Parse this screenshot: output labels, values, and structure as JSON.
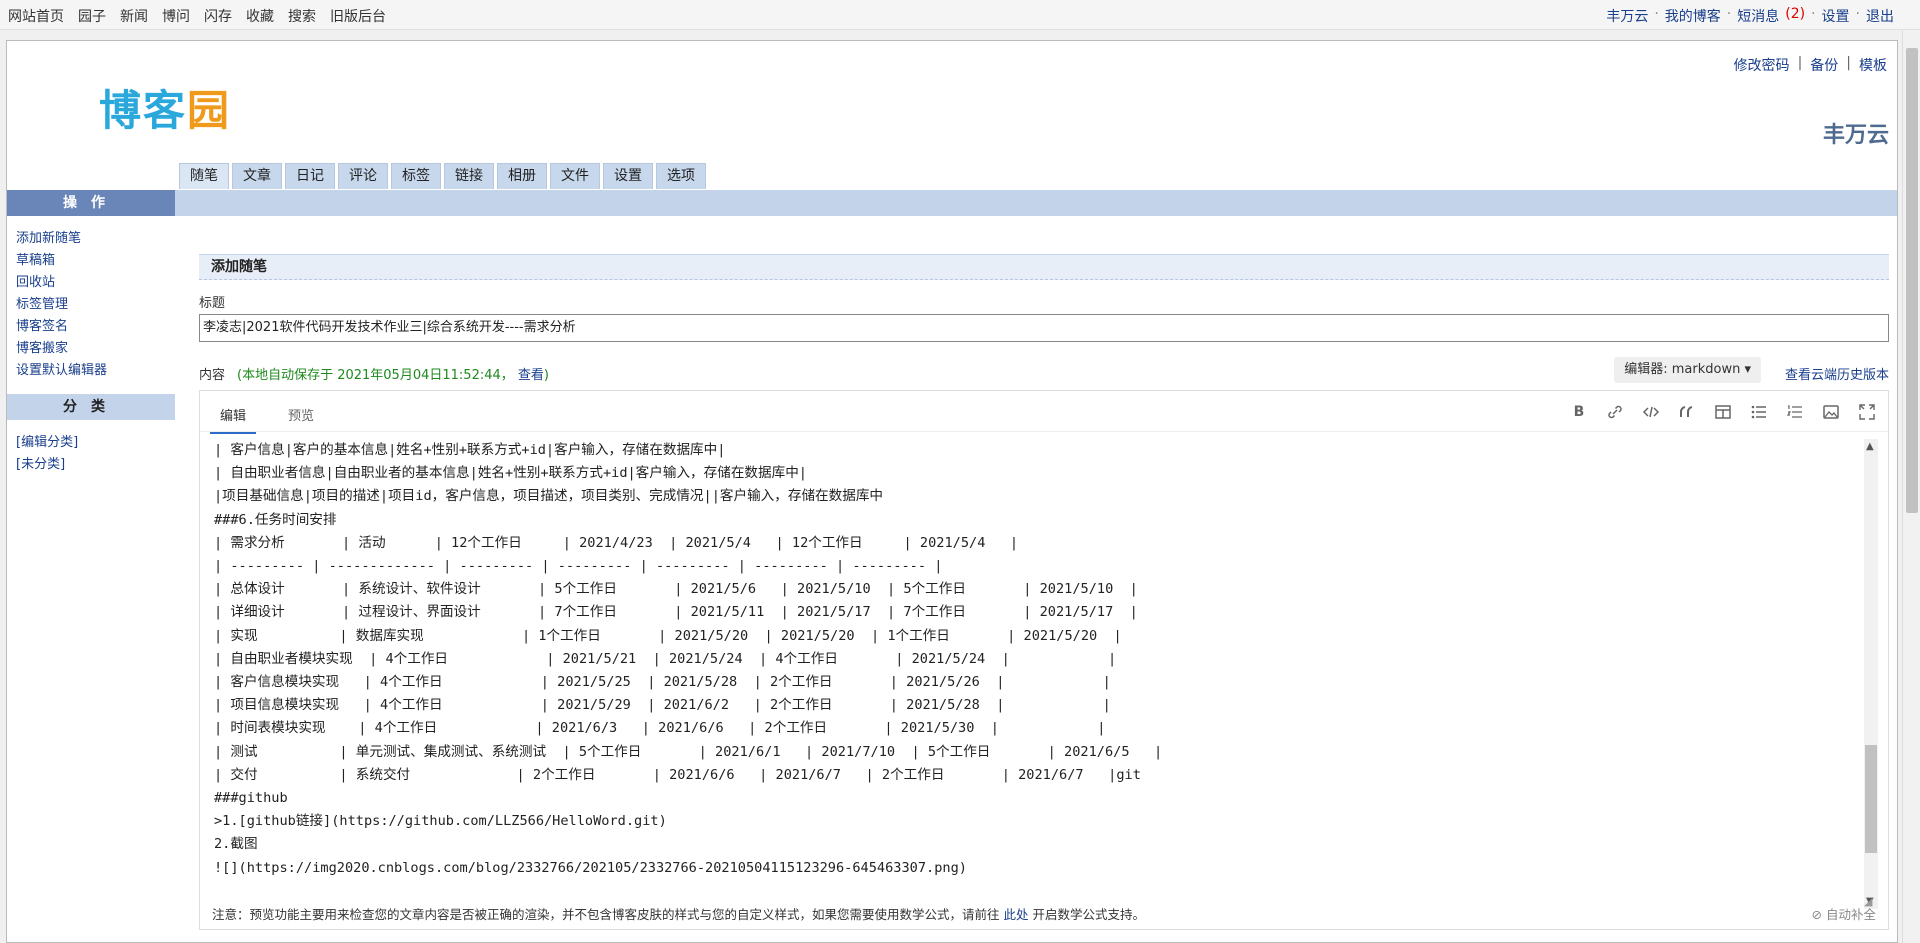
{
  "topnav": {
    "left": [
      "网站首页",
      "园子",
      "新闻",
      "博问",
      "闪存",
      "收藏",
      "搜索",
      "旧版后台"
    ],
    "user": "丰万云",
    "my_blog": "我的博客",
    "messages": "短消息",
    "message_count": "(2)",
    "settings": "设置",
    "logout": "退出"
  },
  "header": {
    "logo_main": "博客",
    "logo_accent": "园",
    "change_password": "修改密码",
    "backup": "备份",
    "template": "模板",
    "username": "丰万云"
  },
  "tabs": [
    "随笔",
    "文章",
    "日记",
    "评论",
    "标签",
    "链接",
    "相册",
    "文件",
    "设置",
    "选项"
  ],
  "sidebar": {
    "ops_title": "操作",
    "ops_items": [
      "添加新随笔",
      "草稿箱",
      "回收站",
      "标签管理",
      "博客签名",
      "博客搬家",
      "设置默认编辑器"
    ],
    "cat_title": "分类",
    "cat_items": [
      "[编辑分类]",
      "[未分类]"
    ]
  },
  "main": {
    "section_title": "添加随笔",
    "title_label": "标题",
    "title_value": "李凌志|2021软件代码开发技术作业三|综合系统开发----需求分析",
    "content_label": "内容",
    "autosave_text": "(本地自动保存于 2021年05月04日11:52:44，",
    "autosave_view": "查看",
    "autosave_close": ")",
    "editor_select": "编辑器: markdown",
    "history": "查看云端历史版本"
  },
  "editor": {
    "tab_edit": "编辑",
    "tab_preview": "预览",
    "lines": [
      "| 客户信息|客户的基本信息|姓名+性别+联系方式+id|客户输入，存储在数据库中|",
      "| 自由职业者信息|自由职业者的基本信息|姓名+性别+联系方式+id|客户输入，存储在数据库中|",
      "|项目基础信息|项目的描述|项目id，客户信息，项目描述，项目类别、完成情况||客户输入，存储在数据库中",
      "###6.任务时间安排",
      "| 需求分析       | 活动      | 12个工作日     | 2021/4/23  | 2021/5/4   | 12个工作日     | 2021/5/4   |",
      "| --------- | ------------- | --------- | --------- | --------- | --------- | --------- |",
      "| 总体设计       | 系统设计、软件设计       | 5个工作日       | 2021/5/6   | 2021/5/10  | 5个工作日       | 2021/5/10  |",
      "| 详细设计       | 过程设计、界面设计       | 7个工作日       | 2021/5/11  | 2021/5/17  | 7个工作日       | 2021/5/17  |",
      "| 实现          | 数据库实现            | 1个工作日       | 2021/5/20  | 2021/5/20  | 1个工作日       | 2021/5/20  |",
      "| 自由职业者模块实现  | 4个工作日            | 2021/5/21  | 2021/5/24  | 4个工作日       | 2021/5/24  |            |",
      "| 客户信息模块实现   | 4个工作日            | 2021/5/25  | 2021/5/28  | 2个工作日       | 2021/5/26  |            |",
      "| 项目信息模块实现   | 4个工作日            | 2021/5/29  | 2021/6/2   | 2个工作日       | 2021/5/28  |            |",
      "| 时间表模块实现    | 4个工作日            | 2021/6/3   | 2021/6/6   | 2个工作日       | 2021/5/30  |            |",
      "| 测试          | 单元测试、集成测试、系统测试  | 5个工作日       | 2021/6/1   | 2021/7/10  | 5个工作日       | 2021/6/5   |",
      "| 交付          | 系统交付             | 2个工作日       | 2021/6/6   | 2021/6/7   | 2个工作日       | 2021/6/7   |git",
      "###github",
      ">1.[github链接](https://github.com/LLZ566/HelloWord.git)",
      "2.截图",
      "![](https://img2020.cnblogs.com/blog/2332766/202105/2332766-20210504115123296-645463307.png)"
    ]
  },
  "footer": {
    "note": "注意：预览功能主要用来检查您的文章内容是否被正确的渲染，并不包含博客皮肤的样式与您的自定义样式，如果您需要使用数学公式，请前往",
    "here": "此处",
    "note_end": "开启数学公式支持。",
    "autocomplete": "自动补全"
  }
}
